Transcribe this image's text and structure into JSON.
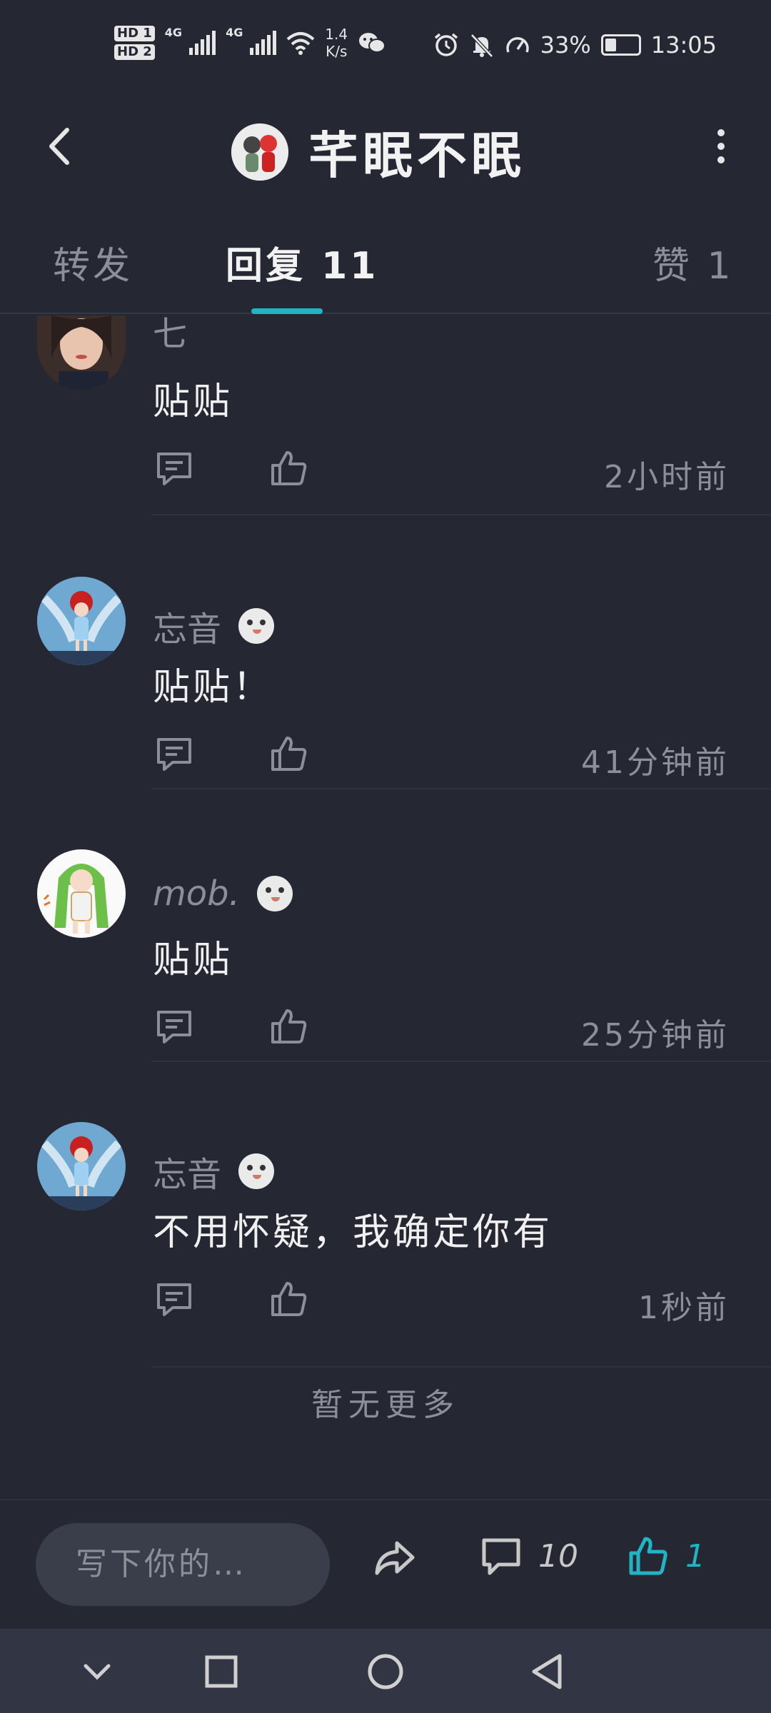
{
  "status_bar": {
    "hd1": "HD 1",
    "hd2": "HD 2",
    "net1": "4G",
    "net2": "4G",
    "net_speed_value": "1.4",
    "net_speed_unit": "K/s",
    "battery_percent_text": "33%",
    "battery_level": 0.33,
    "time": "13:05"
  },
  "header": {
    "title": "芊眠不眠"
  },
  "tabs": {
    "repost": "转发",
    "replies": "回复 11",
    "likes": "赞 1"
  },
  "comments": [
    {
      "username": "七",
      "text": "贴贴",
      "time": "2小时前",
      "badge": false,
      "avatar": "girl-photo"
    },
    {
      "username": "忘音",
      "text": "贴贴！",
      "time": "41分钟前",
      "badge": true,
      "avatar": "anime-winged"
    },
    {
      "username": "mob.",
      "text": "贴贴",
      "time": "25分钟前",
      "badge": true,
      "avatar": "anime-green-hair"
    },
    {
      "username": "忘音",
      "text": "不用怀疑，我确定你有",
      "time": "1秒前",
      "badge": true,
      "avatar": "anime-winged"
    }
  ],
  "no_more": "暂无更多",
  "bottom_bar": {
    "input_placeholder": "写下你的…",
    "comment_count": "10",
    "like_count": "1"
  },
  "colors": {
    "background": "#252733",
    "accent": "#1fb5c4",
    "muted_text": "#8c8f99"
  }
}
